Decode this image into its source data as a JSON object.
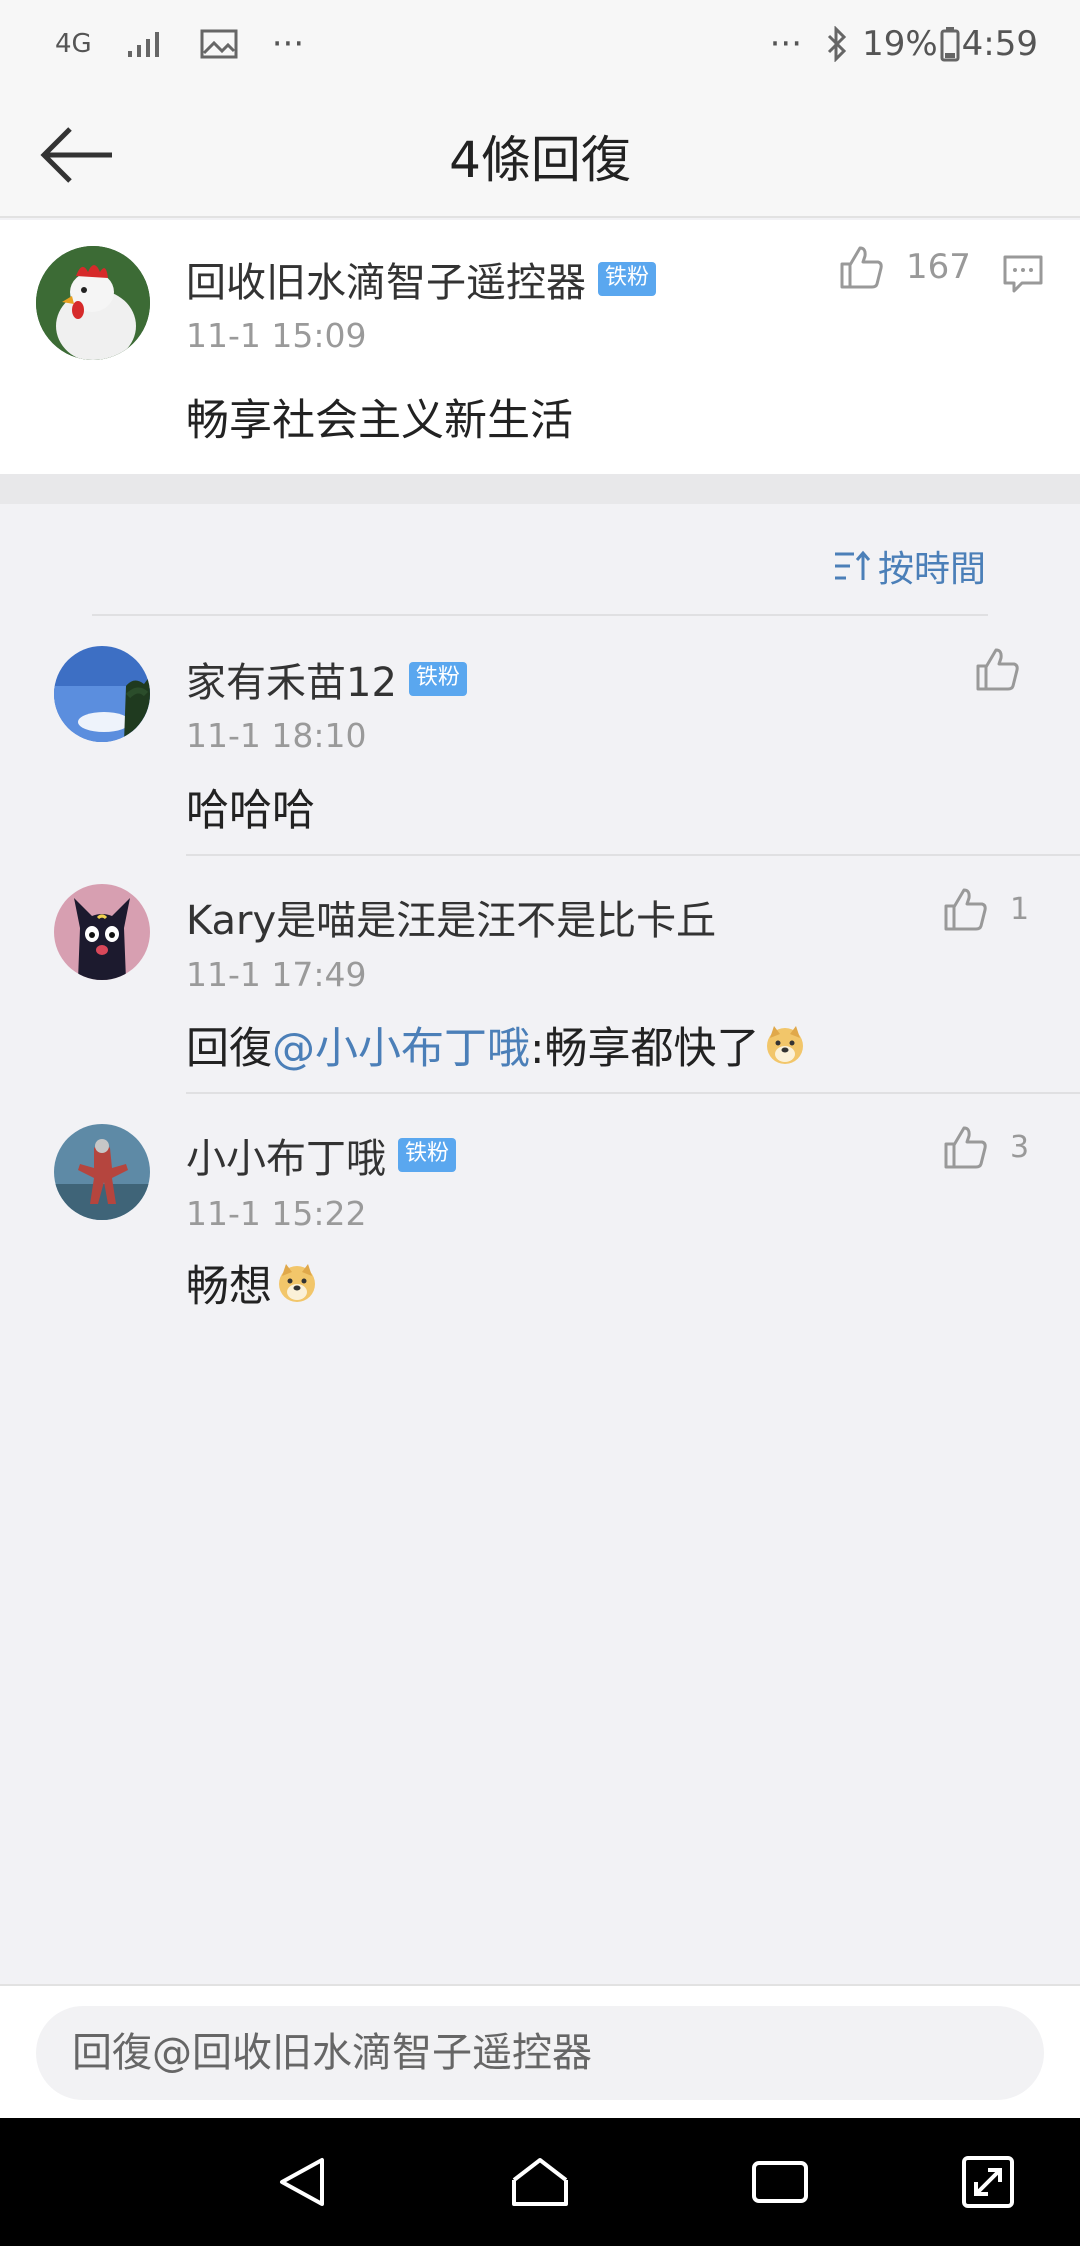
{
  "status_bar": {
    "network": "4G",
    "more_left": "···",
    "more_right": "···",
    "battery": "19%",
    "time": "4:59"
  },
  "nav": {
    "title": "4條回復"
  },
  "original_post": {
    "username": "回收旧水滴智子遥控器",
    "badge": "铁粉",
    "timestamp": "11-1 15:09",
    "content": "畅享社会主义新生活",
    "likes": "167"
  },
  "sort": {
    "label": "按時間"
  },
  "replies": [
    {
      "username": "家有禾苗12",
      "badge": "铁粉",
      "timestamp": "11-1 18:10",
      "content": "哈哈哈",
      "likes": ""
    },
    {
      "username": "Kary是喵是汪是汪不是比卡丘",
      "badge": "",
      "timestamp": "11-1 17:49",
      "content_prefix": "回復",
      "mention": "@小小布丁哦",
      "content_suffix": ":畅享都快了",
      "likes": "1"
    },
    {
      "username": "小小布丁哦",
      "badge": "铁粉",
      "timestamp": "11-1 15:22",
      "content": "畅想",
      "likes": "3"
    }
  ],
  "reply_bar": {
    "placeholder": "回復@回收旧水滴智子遥控器"
  },
  "colors": {
    "accent": "#4b7fb8",
    "badge": "#5aa7ef",
    "background": "#f2f2f5"
  },
  "icons": [
    "back-arrow-icon",
    "thumbs-up-icon",
    "comment-icon",
    "sort-icon",
    "doge-emoji-icon",
    "nav-back-icon",
    "nav-home-icon",
    "nav-recents-icon",
    "nav-expand-icon"
  ]
}
